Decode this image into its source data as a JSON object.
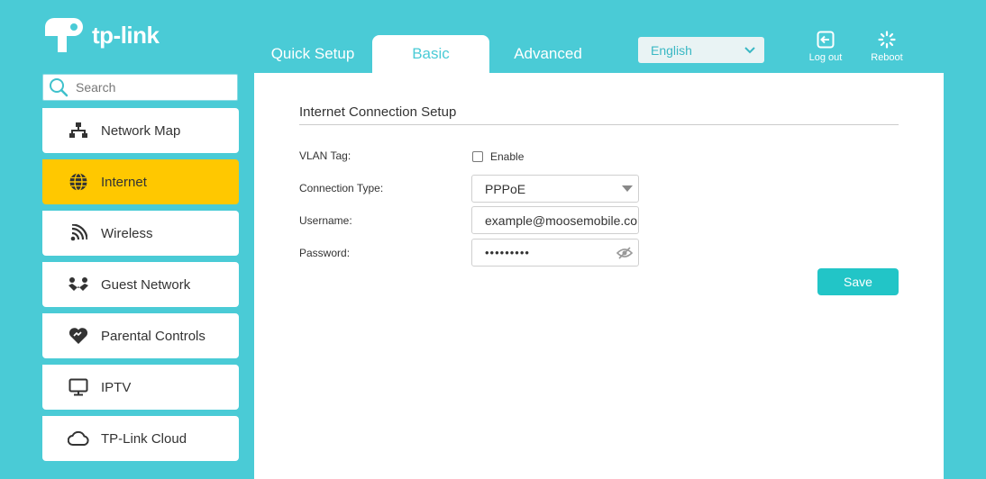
{
  "brand": {
    "logo_text": "tp-link",
    "accent": "#4acbd6",
    "highlight": "#ffc800",
    "button": "#22c5c7"
  },
  "tabs": [
    {
      "label": "Quick Setup",
      "active": false
    },
    {
      "label": "Basic",
      "active": true
    },
    {
      "label": "Advanced",
      "active": false
    }
  ],
  "language": {
    "selected": "English"
  },
  "header_actions": {
    "logout_label": "Log out",
    "reboot_label": "Reboot"
  },
  "search": {
    "placeholder": "Search"
  },
  "sidebar": {
    "items": [
      {
        "label": "Network Map",
        "icon": "network-map-icon",
        "active": false
      },
      {
        "label": "Internet",
        "icon": "globe-icon",
        "active": true
      },
      {
        "label": "Wireless",
        "icon": "wireless-icon",
        "active": false
      },
      {
        "label": "Guest Network",
        "icon": "guest-network-icon",
        "active": false
      },
      {
        "label": "Parental Controls",
        "icon": "heart-icon",
        "active": false
      },
      {
        "label": "IPTV",
        "icon": "monitor-icon",
        "active": false
      },
      {
        "label": "TP-Link Cloud",
        "icon": "cloud-icon",
        "active": false
      }
    ]
  },
  "main": {
    "section_title": "Internet Connection Setup",
    "vlan": {
      "label": "VLAN Tag:",
      "checkbox_label": "Enable",
      "checked": false
    },
    "connection_type": {
      "label": "Connection Type:",
      "value": "PPPoE"
    },
    "username": {
      "label": "Username:",
      "value": "example@moosemobile.com"
    },
    "password": {
      "label": "Password:",
      "value": "•••••••••"
    },
    "save_label": "Save"
  }
}
